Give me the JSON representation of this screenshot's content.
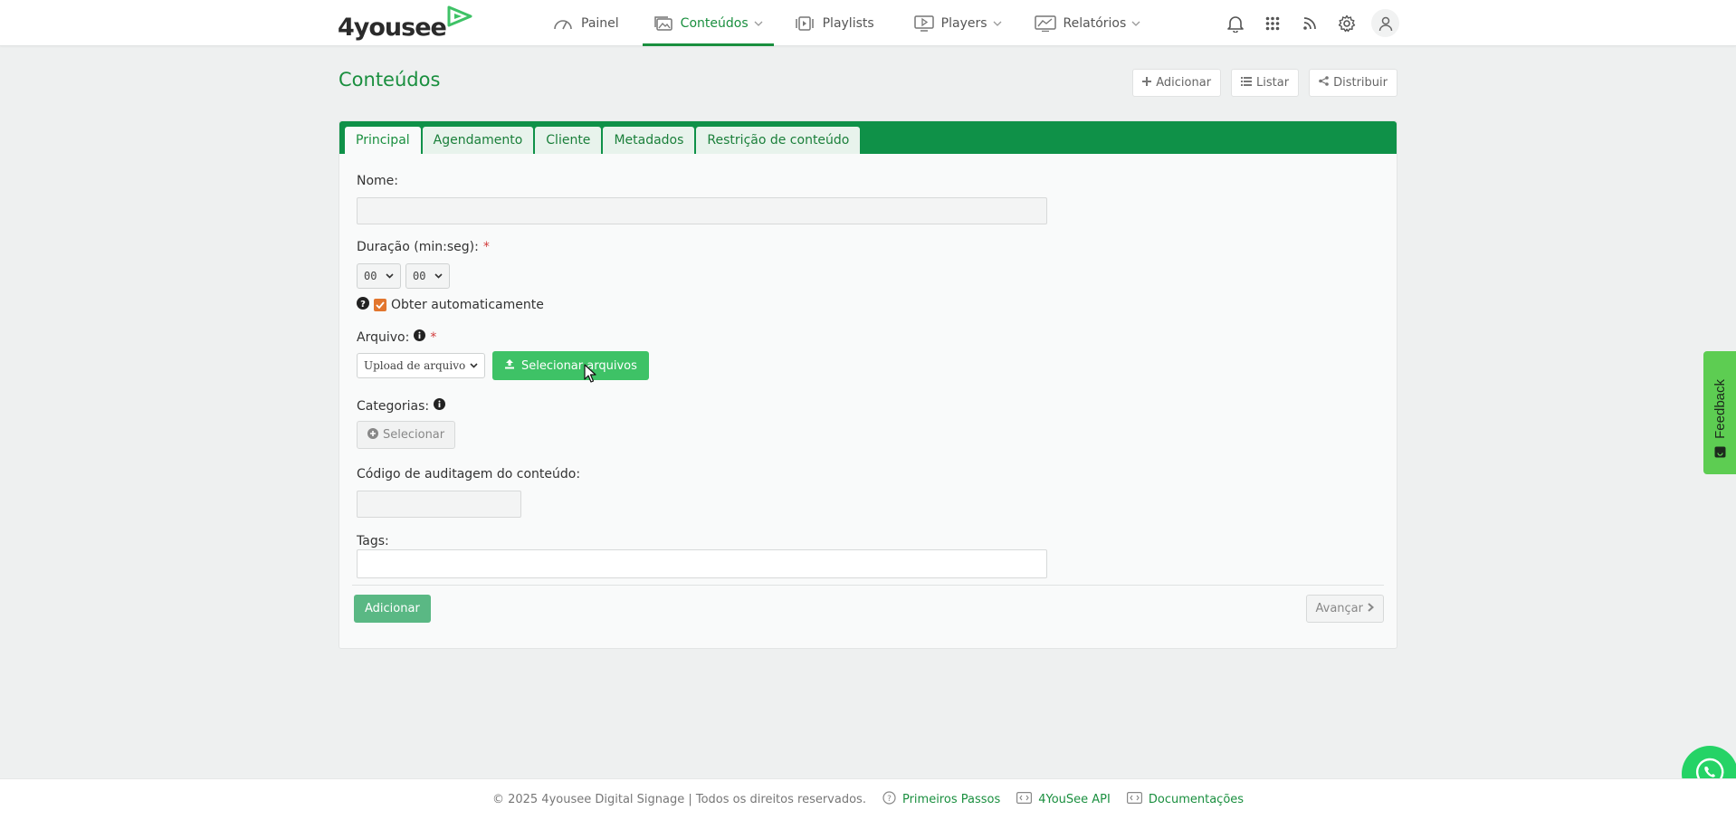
{
  "logo": {
    "text": "4yousee"
  },
  "nav": {
    "items": [
      {
        "label": "Painel",
        "icon": "gauge-icon"
      },
      {
        "label": "Conteúdos",
        "icon": "images-icon",
        "active": true,
        "dropdown": true
      },
      {
        "label": "Playlists",
        "icon": "playlist-icon"
      },
      {
        "label": "Players",
        "icon": "player-icon",
        "dropdown": true
      },
      {
        "label": "Relatórios",
        "icon": "chart-icon",
        "dropdown": true
      }
    ],
    "right_icons": [
      "bell-icon",
      "apps-grid-icon",
      "rss-icon",
      "gear-icon",
      "user-icon"
    ]
  },
  "page": {
    "title": "Conteúdos",
    "actions": [
      {
        "label": "Adicionar",
        "icon": "plus-icon"
      },
      {
        "label": "Listar",
        "icon": "list-icon"
      },
      {
        "label": "Distribuir",
        "icon": "share-icon"
      }
    ]
  },
  "tabs": [
    {
      "label": "Principal",
      "active": true
    },
    {
      "label": "Agendamento"
    },
    {
      "label": "Cliente"
    },
    {
      "label": "Metadados"
    },
    {
      "label": "Restrição de conteúdo"
    }
  ],
  "form": {
    "name_label": "Nome:",
    "name_value": "",
    "duration_label": "Duração (min:seg):",
    "required_mark": "*",
    "duration_min": "00",
    "duration_sec": "00",
    "auto_label": "Obter automaticamente",
    "file_label": "Arquivo:",
    "file_source": "Upload de arquivo",
    "select_files_label": "Selecionar arquivos",
    "categories_label": "Categorias:",
    "categories_button": "Selecionar",
    "audit_label": "Código de auditagem do conteúdo:",
    "audit_value": "",
    "tags_label": "Tags:",
    "tags_value": "",
    "submit_label": "Adicionar",
    "next_label": "Avançar"
  },
  "widgets": {
    "feedback_label": "Feedback"
  },
  "footer": {
    "copyright": "© 2025 4yousee Digital Signage | Todos os direitos reservados.",
    "links": [
      {
        "label": "Primeiros Passos",
        "icon": "question-circle-icon"
      },
      {
        "label": "4YouSee API",
        "icon": "code-icon"
      },
      {
        "label": "Documentações",
        "icon": "code-icon"
      }
    ]
  },
  "colors": {
    "brand_green": "#1a8f3f",
    "tabbar_green": "#0f9148",
    "button_green": "#3ec266",
    "checkbox_orange": "#e2762e"
  }
}
